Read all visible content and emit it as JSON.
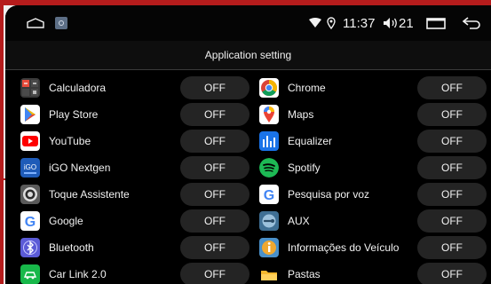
{
  "status_bar": {
    "time": "11:37",
    "volume": "21",
    "icons": [
      "home-icon",
      "gallery-icon",
      "wifi-icon",
      "location-icon",
      "volume-icon",
      "window-icon",
      "back-icon"
    ]
  },
  "header": {
    "title": "Application setting"
  },
  "colors": {
    "casing": "#b51c1c",
    "background": "#000000",
    "button": "#242424",
    "text": "#f2f2f2"
  },
  "apps": [
    {
      "id": "calculadora",
      "name": "Calculadora",
      "state": "OFF",
      "icon": "calculator-icon"
    },
    {
      "id": "chrome",
      "name": "Chrome",
      "state": "OFF",
      "icon": "chrome-icon"
    },
    {
      "id": "play-store",
      "name": "Play Store",
      "state": "OFF",
      "icon": "play-store-icon"
    },
    {
      "id": "maps",
      "name": "Maps",
      "state": "OFF",
      "icon": "maps-icon"
    },
    {
      "id": "youtube",
      "name": "YouTube",
      "state": "OFF",
      "icon": "youtube-icon"
    },
    {
      "id": "equalizer",
      "name": "Equalizer",
      "state": "OFF",
      "icon": "equalizer-icon"
    },
    {
      "id": "igo-nextgen",
      "name": "iGO Nextgen",
      "state": "OFF",
      "icon": "igo-icon",
      "icon_text": "iGO"
    },
    {
      "id": "spotify",
      "name": "Spotify",
      "state": "OFF",
      "icon": "spotify-icon"
    },
    {
      "id": "toque-assistente",
      "name": "Toque Assistente",
      "state": "OFF",
      "icon": "assistive-touch-icon"
    },
    {
      "id": "pesquisa-por-voz",
      "name": "Pesquisa por voz",
      "state": "OFF",
      "icon": "google-voice-icon",
      "icon_text": "G"
    },
    {
      "id": "google",
      "name": "Google",
      "state": "OFF",
      "icon": "google-icon",
      "icon_text": "G"
    },
    {
      "id": "aux",
      "name": "AUX",
      "state": "OFF",
      "icon": "aux-icon"
    },
    {
      "id": "bluetooth",
      "name": "Bluetooth",
      "state": "OFF",
      "icon": "bluetooth-icon"
    },
    {
      "id": "informacoes-do-veiculo",
      "name": "Informações do Veículo",
      "state": "OFF",
      "icon": "vehicle-info-icon"
    },
    {
      "id": "car-link",
      "name": "Car Link 2.0",
      "state": "OFF",
      "icon": "car-link-icon"
    },
    {
      "id": "pastas",
      "name": "Pastas",
      "state": "OFF",
      "icon": "folder-icon"
    }
  ]
}
